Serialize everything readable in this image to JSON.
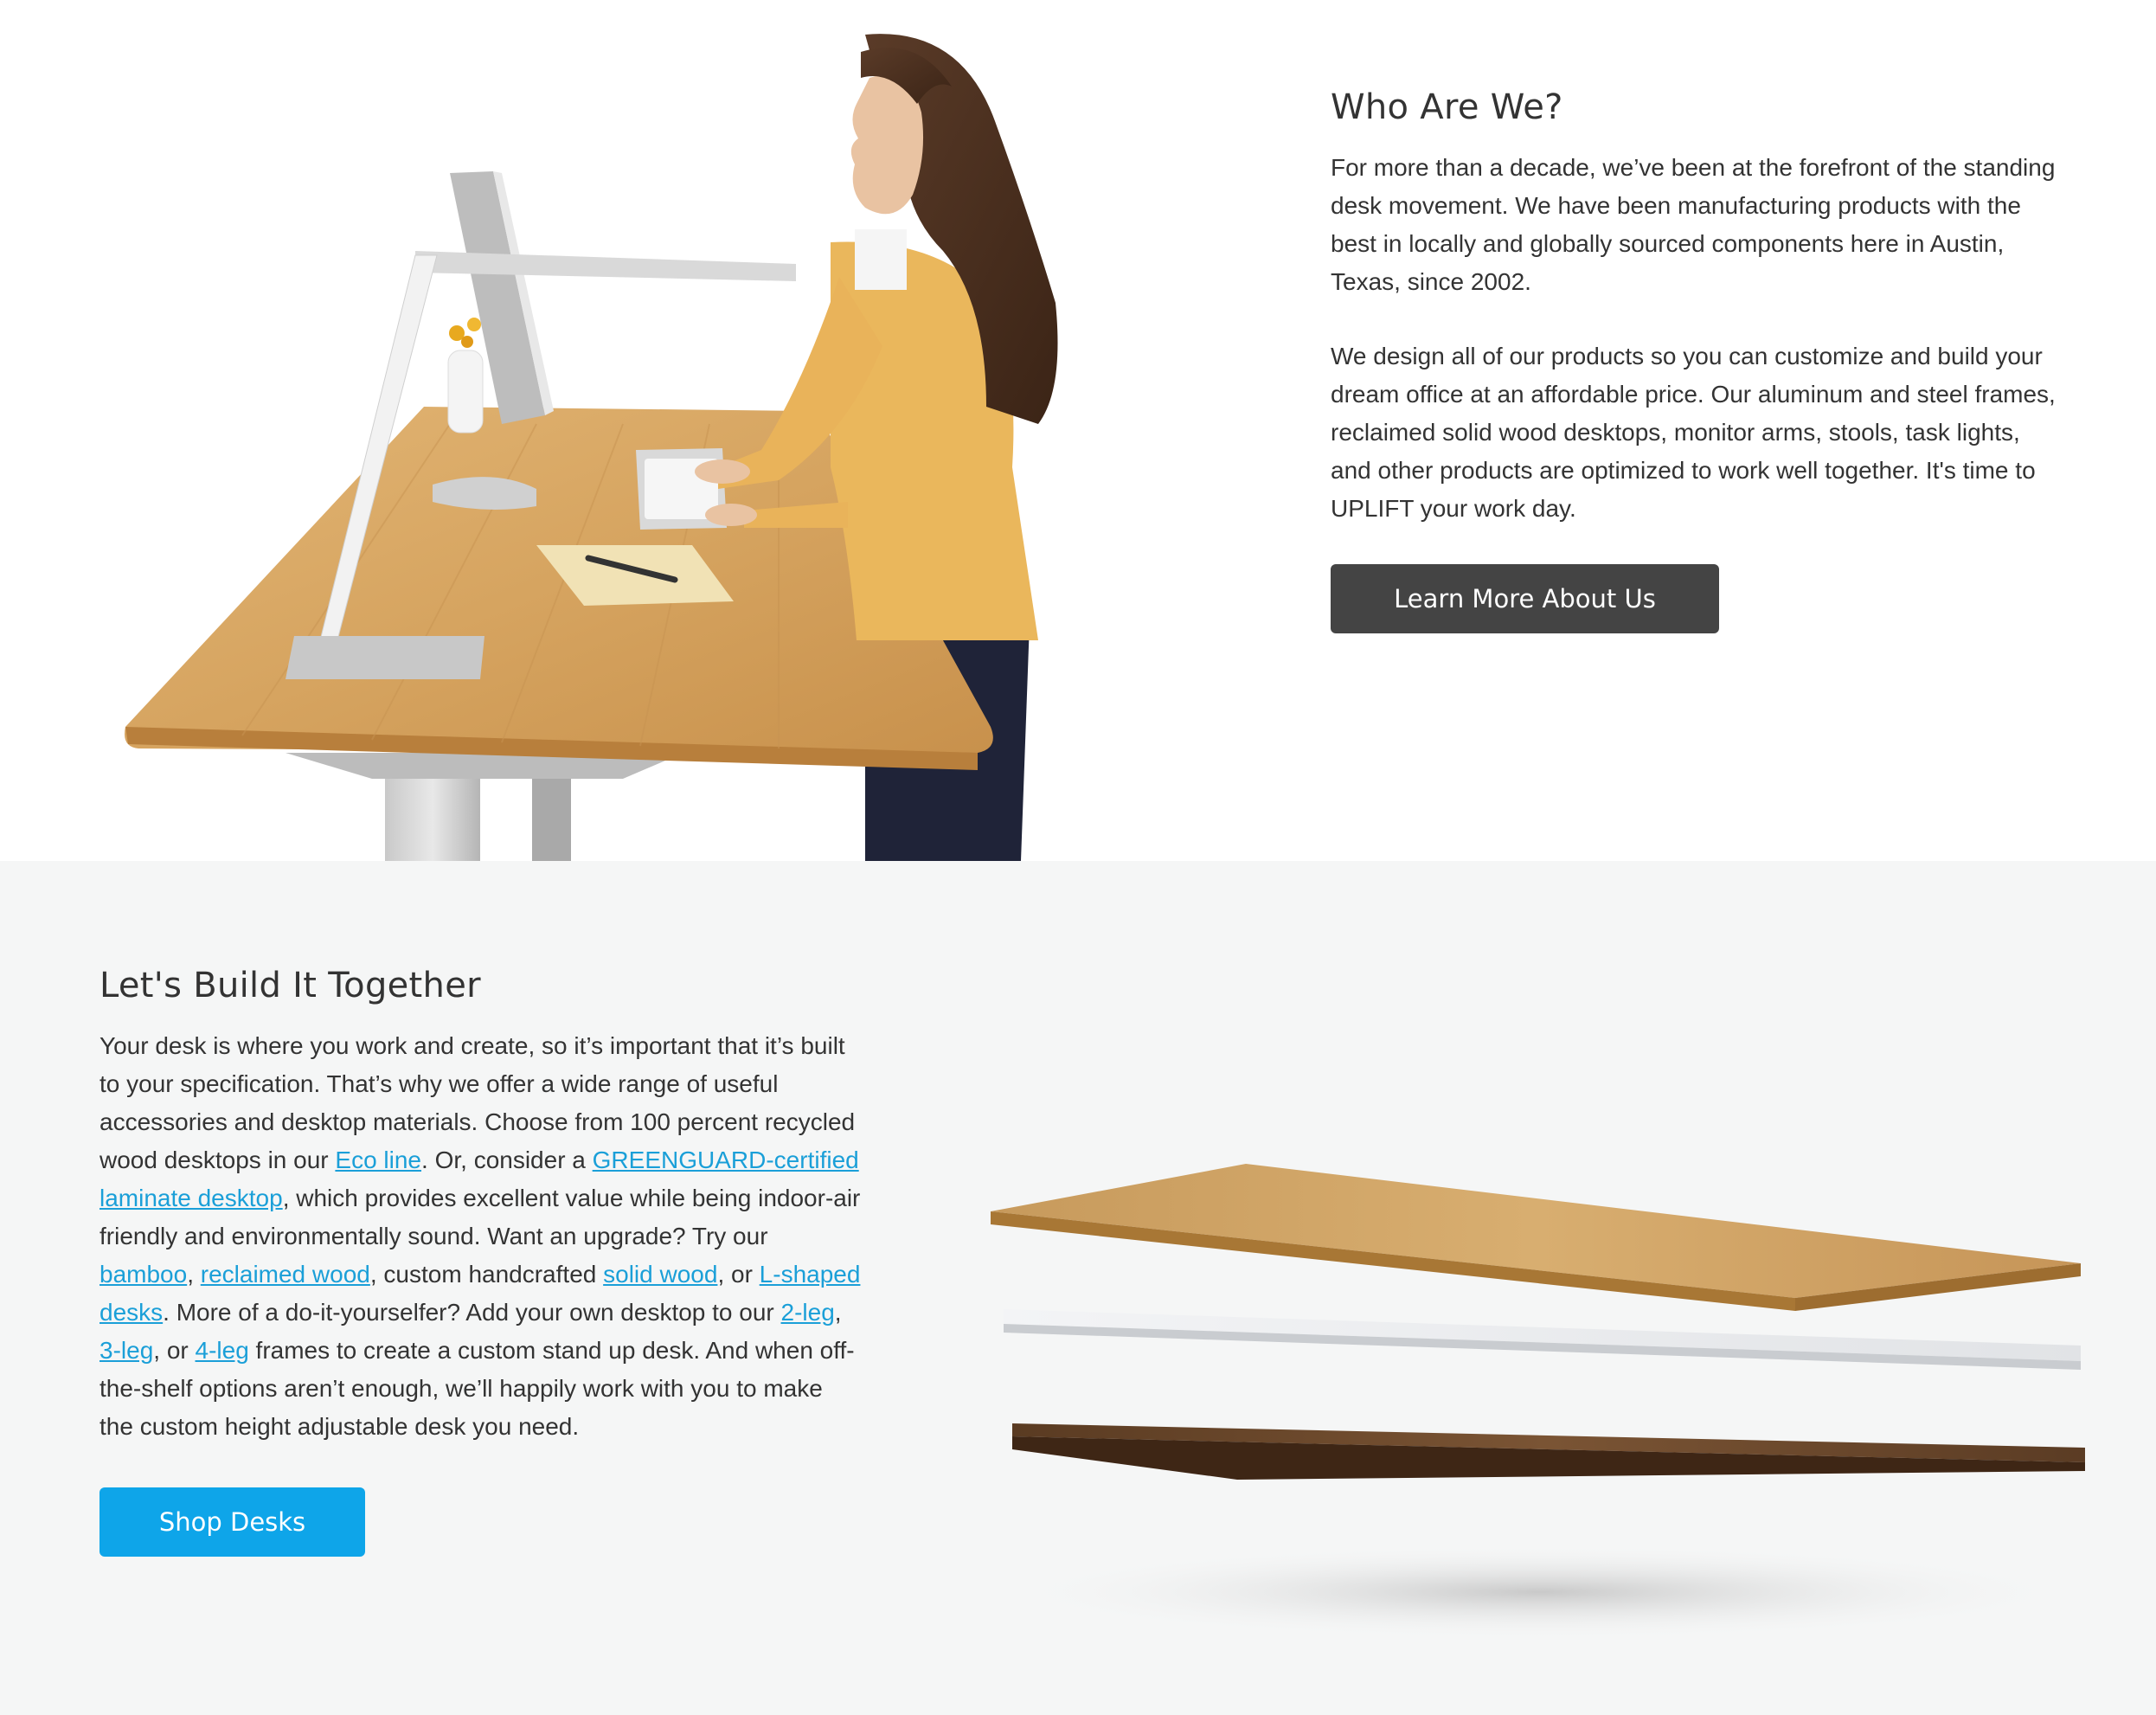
{
  "who": {
    "heading": "Who Are We?",
    "para1": "For more than a decade, we’ve been at the forefront of the standing desk movement. We have been manufacturing products with the best in locally and globally sourced components here in Austin, Texas, since 2002.",
    "para2": "We design all of our products so you can customize and build your dream office at an affordable price. Our aluminum and steel frames, reclaimed solid wood desktops, monitor arms, stools, task lights, and other products are optimized to work well together. It's time to UPLIFT your work day.",
    "button_label": "Learn More About Us"
  },
  "build": {
    "heading": "Let's Build It Together",
    "t1": "Your desk is where you work and create, so it’s important that it’s built to your specification. That’s why we offer a wide range of useful accessories and desktop materials. Choose from 100 percent recycled wood desktops in our ",
    "link_eco": "Eco line",
    "t2": ". Or, consider a ",
    "link_greenguard": "GREENGUARD-certified",
    "t3": " ",
    "link_laminate": "laminate desktop",
    "t4": ", which provides excellent value while being indoor-air friendly and environmentally sound. Want an upgrade? Try our ",
    "link_bamboo": "bamboo",
    "t5": ", ",
    "link_reclaimed": "reclaimed wood",
    "t6": ", custom handcrafted ",
    "link_solid": "solid wood",
    "t7": ", or ",
    "link_lshaped": "L-shaped desks",
    "t8": ". More of a do-it-yourselfer? Add your own desktop to our ",
    "link_2leg": "2-leg",
    "t9": ", ",
    "link_3leg": "3-leg",
    "t10": ", or ",
    "link_4leg": "4-leg",
    "t11": " frames to create a custom stand up desk. And when off-the-shelf options aren’t enough, we’ll happily work with you to make the custom height adjustable desk you need.",
    "button_label": "Shop Desks"
  },
  "colors": {
    "link": "#1a9fd8",
    "button_dark": "#444444",
    "button_blue": "#0ea5e9",
    "section_alt_bg": "#f5f6f6",
    "text": "#333333"
  },
  "images": {
    "hero": "woman-at-standing-desk-photo",
    "desktops": "stacked-desktop-materials-photo"
  }
}
